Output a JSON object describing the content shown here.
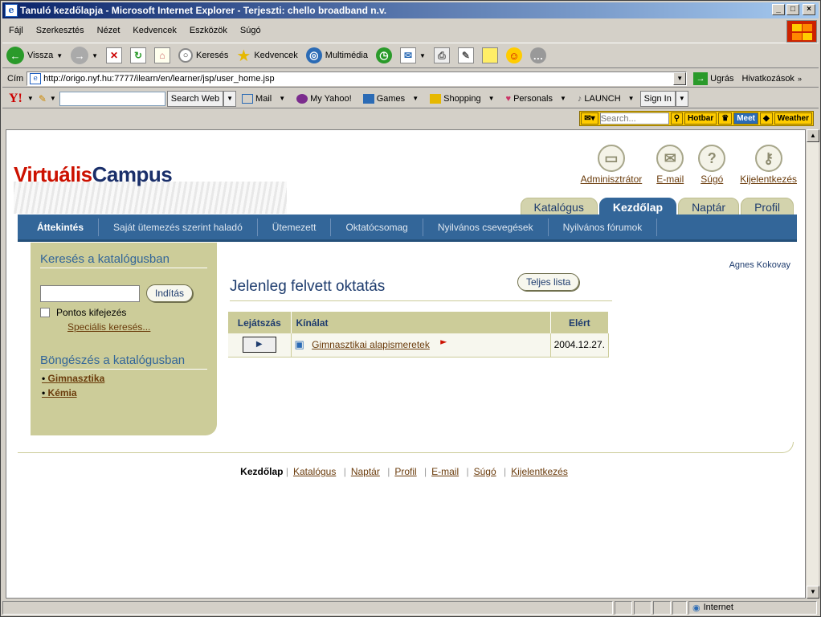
{
  "window": {
    "title": "Tanuló kezdőlapja - Microsoft Internet Explorer - Terjeszti: chello broadband n.v."
  },
  "menu": [
    "Fájl",
    "Szerkesztés",
    "Nézet",
    "Kedvencek",
    "Eszközök",
    "Súgó"
  ],
  "toolbar": {
    "back": "Vissza",
    "search": "Keresés",
    "favorites": "Kedvencek",
    "media": "Multimédia"
  },
  "address": {
    "label": "Cím",
    "url": "http://origo.nyf.hu:7777/ilearn/en/learner/jsp/user_home.jsp",
    "go": "Ugrás",
    "links": "Hivatkozások"
  },
  "yahoo": {
    "logo": "Y!",
    "search_btn": "Search Web",
    "items": [
      "Mail",
      "My Yahoo!",
      "Games",
      "Shopping",
      "Personals",
      "LAUNCH"
    ],
    "signin": "Sign In"
  },
  "hotbar": {
    "search_placeholder": "Search...",
    "hotbar": "Hotbar",
    "meet": "Meet",
    "weather": "Weather"
  },
  "page": {
    "logo_v": "Virtuális",
    "logo_c": "Campus",
    "top_links": [
      "Adminisztrátor",
      "E-mail",
      "Súgó",
      "Kijelentkezés"
    ],
    "tabs": [
      "Katalógus",
      "Kezdőlap",
      "Naptár",
      "Profil"
    ],
    "active_tab": "Kezdőlap",
    "nav": [
      "Áttekintés",
      "Saját ütemezés szerint haladó",
      "Ütemezett",
      "Oktatócsomag",
      "Nyilvános csevegések",
      "Nyilvános fórumok"
    ],
    "search_heading": "Keresés a katalógusban",
    "search_btn": "Indítás",
    "exact": "Pontos kifejezés",
    "special": "Speciális keresés...",
    "browse_heading": "Böngészés a katalógusban",
    "browse_items": [
      "Gimnasztika",
      "Kémia"
    ],
    "user": "Agnes Kokovay",
    "main_heading": "Jelenleg felvett oktatás",
    "full_list": "Teljes lista",
    "table": {
      "headers": [
        "Lejátszás",
        "Kínálat",
        "Elért"
      ],
      "rows": [
        {
          "course": "Gimnasztikai alapismeretek",
          "date": "2004.12.27."
        }
      ]
    },
    "footer": [
      "Kezdőlap",
      "Katalógus",
      "Naptár",
      "Profil",
      "E-mail",
      "Súgó",
      "Kijelentkezés"
    ]
  },
  "status": {
    "zone": "Internet"
  }
}
